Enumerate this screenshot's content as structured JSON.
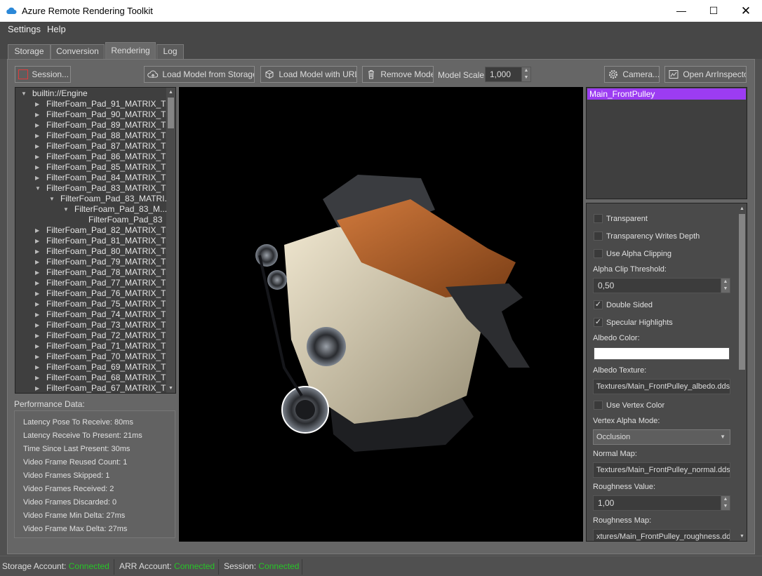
{
  "window": {
    "title": "Azure Remote Rendering Toolkit",
    "app_icon": "cloud-icon",
    "controls": [
      "minimize-icon",
      "maximize-icon",
      "close-icon"
    ]
  },
  "menu": [
    "Settings",
    "Help"
  ],
  "tabs": [
    {
      "label": "Storage",
      "active": false
    },
    {
      "label": "Conversion",
      "active": false
    },
    {
      "label": "Rendering",
      "active": true
    },
    {
      "label": "Log",
      "active": false
    }
  ],
  "toolbar": {
    "session": "Session...",
    "load_storage": "Load Model from Storage...",
    "load_url": "Load Model with URL...",
    "remove": "Remove Models",
    "model_scale_label": "Model Scale:",
    "model_scale_value": "1,000",
    "camera": "Camera...",
    "inspector": "Open ArrInspector"
  },
  "tree": [
    {
      "text": "builtin://Engine",
      "level": 0,
      "expanded": true
    },
    {
      "text": "FilterFoam_Pad_91_MATRIX_Tr...",
      "level": 1,
      "expanded": false
    },
    {
      "text": "FilterFoam_Pad_90_MATRIX_Tr...",
      "level": 1,
      "expanded": false
    },
    {
      "text": "FilterFoam_Pad_89_MATRIX_Tr...",
      "level": 1,
      "expanded": false
    },
    {
      "text": "FilterFoam_Pad_88_MATRIX_Tr...",
      "level": 1,
      "expanded": false
    },
    {
      "text": "FilterFoam_Pad_87_MATRIX_Tr...",
      "level": 1,
      "expanded": false
    },
    {
      "text": "FilterFoam_Pad_86_MATRIX_Tr...",
      "level": 1,
      "expanded": false
    },
    {
      "text": "FilterFoam_Pad_85_MATRIX_Tr...",
      "level": 1,
      "expanded": false
    },
    {
      "text": "FilterFoam_Pad_84_MATRIX_Tr...",
      "level": 1,
      "expanded": false
    },
    {
      "text": "FilterFoam_Pad_83_MATRIX_Tr...",
      "level": 1,
      "expanded": true
    },
    {
      "text": "FilterFoam_Pad_83_MATRI...",
      "level": 2,
      "expanded": true
    },
    {
      "text": "FilterFoam_Pad_83_M...",
      "level": 3,
      "expanded": true
    },
    {
      "text": "FilterFoam_Pad_83",
      "level": 4,
      "leaf": true
    },
    {
      "text": "FilterFoam_Pad_82_MATRIX_Tr...",
      "level": 1,
      "expanded": false
    },
    {
      "text": "FilterFoam_Pad_81_MATRIX_Tr...",
      "level": 1,
      "expanded": false
    },
    {
      "text": "FilterFoam_Pad_80_MATRIX_Tr...",
      "level": 1,
      "expanded": false
    },
    {
      "text": "FilterFoam_Pad_79_MATRIX_Tr...",
      "level": 1,
      "expanded": false
    },
    {
      "text": "FilterFoam_Pad_78_MATRIX_Tr...",
      "level": 1,
      "expanded": false
    },
    {
      "text": "FilterFoam_Pad_77_MATRIX_Tr...",
      "level": 1,
      "expanded": false
    },
    {
      "text": "FilterFoam_Pad_76_MATRIX_Tr...",
      "level": 1,
      "expanded": false
    },
    {
      "text": "FilterFoam_Pad_75_MATRIX_Tr...",
      "level": 1,
      "expanded": false
    },
    {
      "text": "FilterFoam_Pad_74_MATRIX_Tr...",
      "level": 1,
      "expanded": false
    },
    {
      "text": "FilterFoam_Pad_73_MATRIX_Tr...",
      "level": 1,
      "expanded": false
    },
    {
      "text": "FilterFoam_Pad_72_MATRIX_Tr...",
      "level": 1,
      "expanded": false
    },
    {
      "text": "FilterFoam_Pad_71_MATRIX_Tr...",
      "level": 1,
      "expanded": false
    },
    {
      "text": "FilterFoam_Pad_70_MATRIX_Tr...",
      "level": 1,
      "expanded": false
    },
    {
      "text": "FilterFoam_Pad_69_MATRIX_Tr...",
      "level": 1,
      "expanded": false
    },
    {
      "text": "FilterFoam_Pad_68_MATRIX_Tr...",
      "level": 1,
      "expanded": false
    },
    {
      "text": "FilterFoam_Pad_67_MATRIX_Tr...",
      "level": 1,
      "expanded": false
    }
  ],
  "performance": {
    "title": "Performance Data:",
    "lines": [
      "Latency Pose To Receive: 80ms",
      "Latency Receive To Present: 21ms",
      "Time Since Last Present: 30ms",
      "Video Frame Reused Count: 1",
      "Video Frames Skipped: 1",
      "Video Frames Received: 2",
      "Video Frames Discarded: 0",
      "Video Frame Min Delta: 27ms",
      "Video Frame Max Delta: 27ms"
    ]
  },
  "selection": {
    "item": "Main_FrontPulley",
    "highlight_color": "#9c3cf2"
  },
  "material": {
    "transparent": {
      "label": "Transparent",
      "checked": false
    },
    "transparency_writes_depth": {
      "label": "Transparency Writes Depth",
      "checked": false
    },
    "use_alpha_clipping": {
      "label": "Use Alpha Clipping",
      "checked": false
    },
    "alpha_clip_threshold_label": "Alpha Clip Threshold:",
    "alpha_clip_threshold": "0,50",
    "double_sided": {
      "label": "Double Sided",
      "checked": true
    },
    "specular_highlights": {
      "label": "Specular Highlights",
      "checked": true
    },
    "albedo_color_label": "Albedo Color:",
    "albedo_color": "#ffffff",
    "albedo_texture_label": "Albedo Texture:",
    "albedo_texture": "Textures/Main_FrontPulley_albedo.dds",
    "use_vertex_color": {
      "label": "Use Vertex Color",
      "checked": false
    },
    "vertex_alpha_mode_label": "Vertex Alpha Mode:",
    "vertex_alpha_mode": "Occlusion",
    "normal_map_label": "Normal Map:",
    "normal_map": "Textures/Main_FrontPulley_normal.dds",
    "roughness_value_label": "Roughness Value:",
    "roughness_value": "1,00",
    "roughness_map_label": "Roughness Map:",
    "roughness_map": "xtures/Main_FrontPulley_roughness.dds"
  },
  "status": {
    "storage_label": "Storage Account:",
    "storage_value": "Connected",
    "arr_label": "ARR Account:",
    "arr_value": "Connected",
    "session_label": "Session:",
    "session_value": "Connected",
    "ok_color": "#27c427"
  }
}
